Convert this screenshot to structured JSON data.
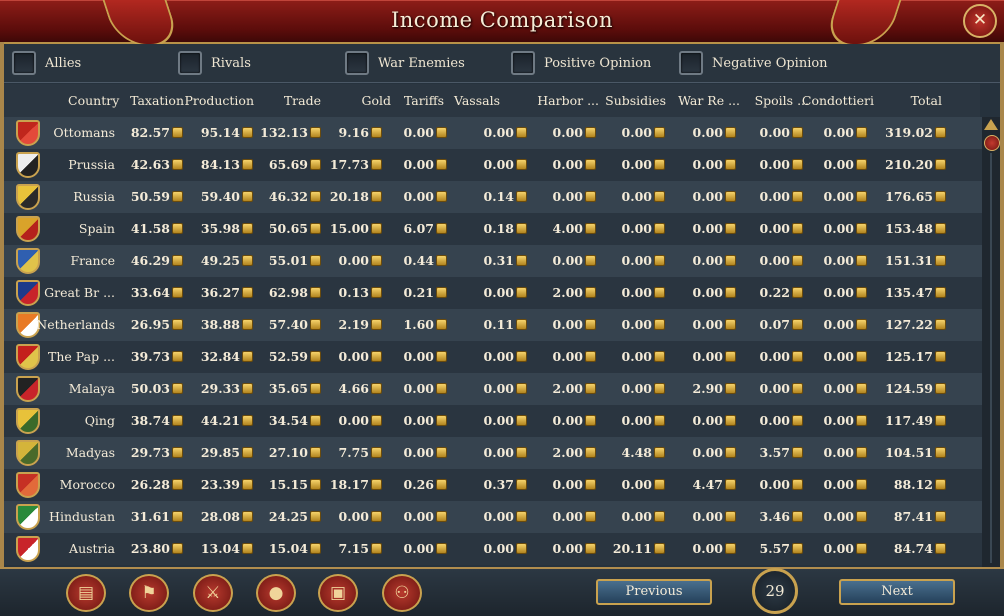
{
  "window": {
    "title": "Income Comparison",
    "close_label": "✕"
  },
  "filters": [
    {
      "label": "Allies"
    },
    {
      "label": "Rivals"
    },
    {
      "label": "War Enemies"
    },
    {
      "label": "Positive Opinion"
    },
    {
      "label": "Negative Opinion"
    }
  ],
  "columns": [
    "Country",
    "Taxation",
    "Production",
    "Trade",
    "Gold",
    "Tariffs",
    "Vassals",
    "Harbor ...",
    "Subsidies",
    "War Re ...",
    "Spoils ...",
    "Condottieri",
    "Total"
  ],
  "rows": [
    {
      "country": "Ottomans",
      "flag": [
        "#c0261c",
        "#e44a3a"
      ],
      "values": [
        "82.57",
        "95.14",
        "132.13",
        "9.16",
        "0.00",
        "0.00",
        "0.00",
        "0.00",
        "0.00",
        "0.00",
        "0.00",
        "319.02"
      ]
    },
    {
      "country": "Prussia",
      "flag": [
        "#eeeeee",
        "#222222"
      ],
      "values": [
        "42.63",
        "84.13",
        "65.69",
        "17.73",
        "0.00",
        "0.00",
        "0.00",
        "0.00",
        "0.00",
        "0.00",
        "0.00",
        "210.20"
      ]
    },
    {
      "country": "Russia",
      "flag": [
        "#e8c23a",
        "#2a2a2a"
      ],
      "values": [
        "50.59",
        "59.40",
        "46.32",
        "20.18",
        "0.00",
        "0.14",
        "0.00",
        "0.00",
        "0.00",
        "0.00",
        "0.00",
        "176.65"
      ]
    },
    {
      "country": "Spain",
      "flag": [
        "#d9a32a",
        "#b5211c"
      ],
      "values": [
        "41.58",
        "35.98",
        "50.65",
        "15.00",
        "6.07",
        "0.18",
        "4.00",
        "0.00",
        "0.00",
        "0.00",
        "0.00",
        "153.48"
      ]
    },
    {
      "country": "France",
      "flag": [
        "#2f5fb0",
        "#e0c34a"
      ],
      "values": [
        "46.29",
        "49.25",
        "55.01",
        "0.00",
        "0.44",
        "0.31",
        "0.00",
        "0.00",
        "0.00",
        "0.00",
        "0.00",
        "151.31"
      ]
    },
    {
      "country": "Great Br ...",
      "flag": [
        "#1d3a8a",
        "#c8242a"
      ],
      "values": [
        "33.64",
        "36.27",
        "62.98",
        "0.13",
        "0.21",
        "0.00",
        "2.00",
        "0.00",
        "0.00",
        "0.22",
        "0.00",
        "135.47"
      ]
    },
    {
      "country": "Netherlands",
      "flag": [
        "#e87a25",
        "#ffffff"
      ],
      "values": [
        "26.95",
        "38.88",
        "57.40",
        "2.19",
        "1.60",
        "0.11",
        "0.00",
        "0.00",
        "0.00",
        "0.07",
        "0.00",
        "127.22"
      ]
    },
    {
      "country": "The Pap ...",
      "flag": [
        "#c4201c",
        "#e0c34a"
      ],
      "values": [
        "39.73",
        "32.84",
        "52.59",
        "0.00",
        "0.00",
        "0.00",
        "0.00",
        "0.00",
        "0.00",
        "0.00",
        "0.00",
        "125.17"
      ]
    },
    {
      "country": "Malaya",
      "flag": [
        "#222222",
        "#c8242a"
      ],
      "values": [
        "50.03",
        "29.33",
        "35.65",
        "4.66",
        "0.00",
        "0.00",
        "2.00",
        "0.00",
        "2.90",
        "0.00",
        "0.00",
        "124.59"
      ]
    },
    {
      "country": "Qing",
      "flag": [
        "#e8c23a",
        "#3a6a2a"
      ],
      "values": [
        "38.74",
        "44.21",
        "34.54",
        "0.00",
        "0.00",
        "0.00",
        "0.00",
        "0.00",
        "0.00",
        "0.00",
        "0.00",
        "117.49"
      ]
    },
    {
      "country": "Madyas",
      "flag": [
        "#d4b43a",
        "#4a6a2a"
      ],
      "values": [
        "29.73",
        "29.85",
        "27.10",
        "7.75",
        "0.00",
        "0.00",
        "2.00",
        "4.48",
        "0.00",
        "3.57",
        "0.00",
        "104.51"
      ]
    },
    {
      "country": "Morocco",
      "flag": [
        "#c63024",
        "#e26a3a"
      ],
      "values": [
        "26.28",
        "23.39",
        "15.15",
        "18.17",
        "0.26",
        "0.37",
        "0.00",
        "0.00",
        "4.47",
        "0.00",
        "0.00",
        "88.12"
      ]
    },
    {
      "country": "Hindustan",
      "flag": [
        "#2a8a3a",
        "#ffffff"
      ],
      "values": [
        "31.61",
        "28.08",
        "24.25",
        "0.00",
        "0.00",
        "0.00",
        "0.00",
        "0.00",
        "0.00",
        "3.46",
        "0.00",
        "87.41"
      ]
    },
    {
      "country": "Austria",
      "flag": [
        "#c8242a",
        "#ffffff"
      ],
      "values": [
        "23.80",
        "13.04",
        "15.04",
        "7.15",
        "0.00",
        "0.00",
        "0.00",
        "20.11",
        "0.00",
        "5.57",
        "0.00",
        "84.74"
      ]
    }
  ],
  "bottom_buttons": [
    {
      "icon": "ledger-icon",
      "glyph": "▤"
    },
    {
      "icon": "flags-icon",
      "glyph": "⚑"
    },
    {
      "icon": "crossed-swords-icon",
      "glyph": "⚔"
    },
    {
      "icon": "coins-icon",
      "glyph": "●"
    },
    {
      "icon": "crate-icon",
      "glyph": "▣"
    },
    {
      "icon": "handshake-icon",
      "glyph": "⚇"
    }
  ],
  "pagination": {
    "previous_label": "Previous",
    "next_label": "Next",
    "page": "29"
  }
}
